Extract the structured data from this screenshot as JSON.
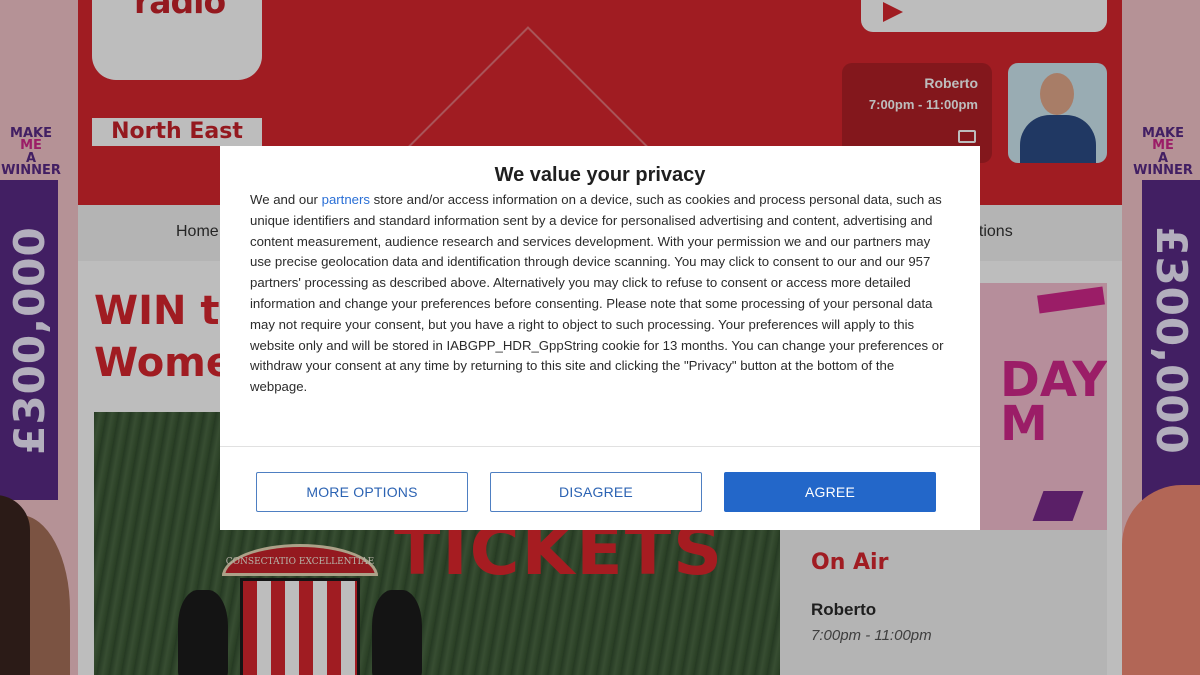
{
  "site": {
    "logo_text": "radio",
    "region": "North East"
  },
  "header": {
    "presenter_name": "Roberto",
    "show_time": "7:00pm - 11:00pm"
  },
  "nav": {
    "items": [
      "Home",
      "ations"
    ]
  },
  "article": {
    "headline_line1": "WIN ti",
    "headline_line2": "Wome",
    "hero_text": "TICKETS",
    "crest_motto": "CONSECTATIO EXCELLENTIAE"
  },
  "sidebar": {
    "ad_text": "DAY\nM",
    "on_air_title": "On Air",
    "presenter": "Roberto",
    "time": "7:00pm - 11:00pm"
  },
  "side_ad": {
    "amount": "£300,000",
    "promo_line1": "MAKE",
    "promo_line2": "ME",
    "promo_line3": "A WINNER"
  },
  "consent": {
    "title": "We value your privacy",
    "text_before_link": "We and our ",
    "link_text": "partners",
    "text_after_link": " store and/or access information on a device, such as cookies and process personal data, such as unique identifiers and standard information sent by a device for personalised advertising and content, advertising and content measurement, audience research and services development. With your permission we and our partners may use precise geolocation data and identification through device scanning. You may click to consent to our and our 957 partners' processing as described above. Alternatively you may click to refuse to consent or access more detailed information and change your preferences before consenting. Please note that some processing of your personal data may not require your consent, but you have a right to object to such processing. Your preferences will apply to this website only and will be stored in IABGPP_HDR_GppString cookie for 13 months. You can change your preferences or withdraw your consent at any time by returning to this site and clicking the \"Privacy\" button at the bottom of the webpage.",
    "buttons": {
      "more_options": "MORE OPTIONS",
      "disagree": "DISAGREE",
      "agree": "AGREE"
    },
    "colors": {
      "primary": "#2367c9",
      "link": "#2a6fd6"
    }
  },
  "colors": {
    "brand_red": "#d8272f",
    "promo_purple": "#5a2a86",
    "promo_pink": "#d2288c"
  }
}
